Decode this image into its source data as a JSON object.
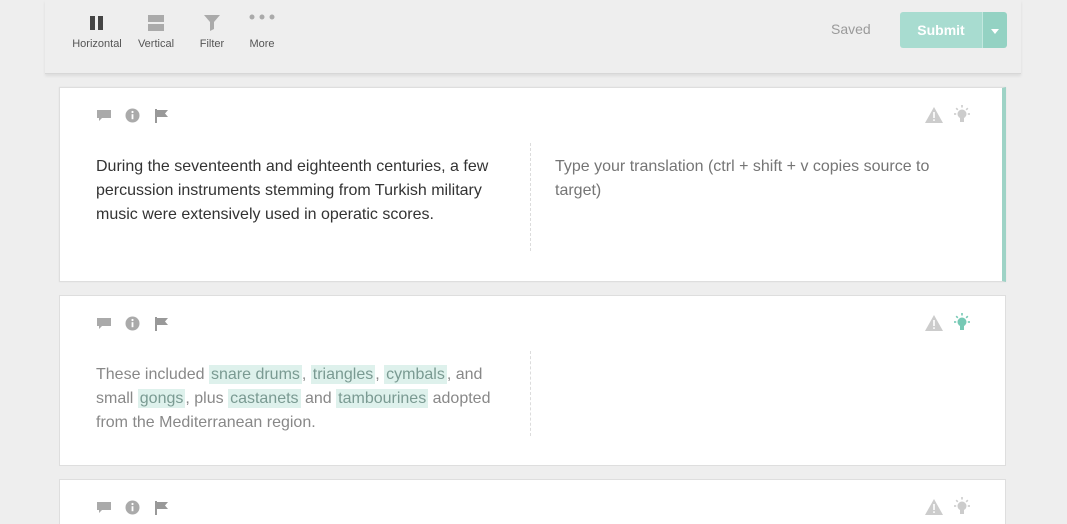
{
  "toolbar": {
    "horizontal_label": "Horizontal",
    "vertical_label": "Vertical",
    "filter_label": "Filter",
    "more_label": "More",
    "saved_label": "Saved",
    "submit_label": "Submit",
    "icons": [
      "pause-columns-icon",
      "stacked-rows-icon",
      "funnel-icon",
      "ellipsis-icon",
      "caret-down-icon"
    ]
  },
  "colors": {
    "accent": "#9ed3c6",
    "submit": "#a8dcd0",
    "term_highlight": "#def1ec",
    "lightbulb_active": "#76c9b5"
  },
  "segments": [
    {
      "source": "During the seventeenth and eighteenth centuries, a few percussion instruments stemming from Turkish military music were extensively used in operatic scores.",
      "target_placeholder": "Type your translation (ctrl + shift + v copies source to target)",
      "active": true
    },
    {
      "source_parts": {
        "p0": "These included ",
        "t0": "snare drums",
        "p1": ", ",
        "t1": "triangles",
        "p2": ", ",
        "t2": "cymbals",
        "p3": ", and small ",
        "t3": "gongs",
        "p4": ", plus ",
        "t4": "castanets",
        "p5": " and ",
        "t5": "tambourines",
        "p6": " adopted from the Mediterranean region."
      },
      "target_placeholder": "",
      "active": false
    },
    {
      "active": false
    }
  ]
}
